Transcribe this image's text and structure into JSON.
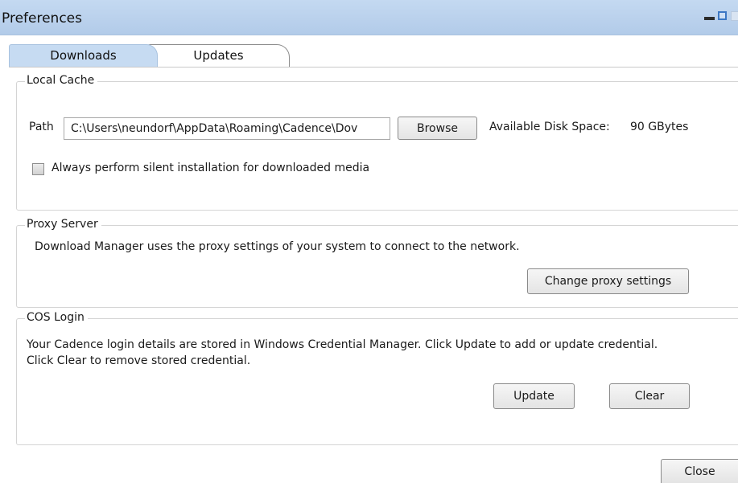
{
  "window": {
    "title": "Preferences"
  },
  "tabs": [
    {
      "label": "Downloads",
      "selected": true
    },
    {
      "label": "Updates",
      "selected": false
    }
  ],
  "local_cache": {
    "legend": "Local Cache",
    "path_label": "Path",
    "path_value": "C:\\Users\\neundorf\\AppData\\Roaming\\Cadence\\Dov",
    "browse_label": "Browse",
    "disk_space_label": "Available Disk Space:",
    "disk_space_value": "90 GBytes",
    "silent_install_label": "Always perform silent installation for downloaded media",
    "silent_install_checked": false
  },
  "proxy_server": {
    "legend": "Proxy Server",
    "description": "Download Manager uses the proxy settings of your system to connect to the network.",
    "change_label": "Change proxy settings"
  },
  "cos_login": {
    "legend": "COS Login",
    "description_line1": "Your Cadence login details are stored in Windows Credential Manager. Click Update to add or update credential.",
    "description_line2": "Click Clear to remove stored credential.",
    "update_label": "Update",
    "clear_label": "Clear"
  },
  "footer": {
    "close_label": "Close"
  },
  "colors": {
    "titlebar": "#b8d0ec",
    "selected_tab": "#c6dbf2"
  }
}
